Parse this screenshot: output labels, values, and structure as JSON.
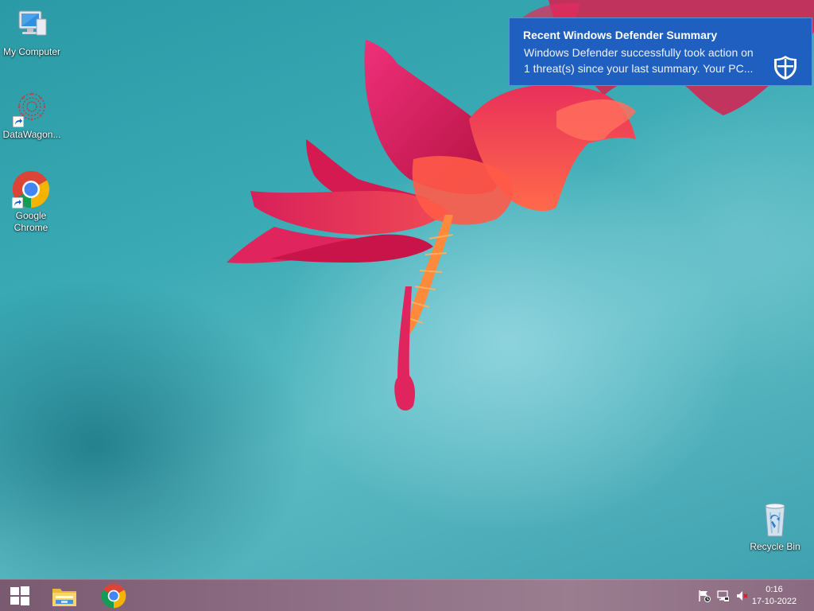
{
  "desktop": {
    "icons": [
      {
        "label": "My Computer",
        "icon": "computer-icon"
      },
      {
        "label": "DataWagon...",
        "icon": "datawagon-icon"
      },
      {
        "label": "Google Chrome",
        "icon": "chrome-icon"
      },
      {
        "label": "Recycle Bin",
        "icon": "recycle-bin-icon"
      }
    ]
  },
  "notification": {
    "title": "Recent Windows Defender Summary",
    "body": "Windows Defender successfully took action on 1 threat(s) since your last summary. Your PC...",
    "icon": "defender-shield-icon",
    "background": "#1f5fbf"
  },
  "taskbar": {
    "pinned": [
      {
        "name": "start-button",
        "icon": "windows-logo-icon"
      },
      {
        "name": "file-explorer-button",
        "icon": "folder-icon"
      },
      {
        "name": "chrome-taskbar-button",
        "icon": "chrome-icon"
      }
    ],
    "tray": [
      {
        "name": "action-center-icon"
      },
      {
        "name": "network-icon"
      },
      {
        "name": "volume-muted-icon"
      }
    ],
    "clock": {
      "time": "0:16",
      "date": "17-10-2022"
    }
  },
  "colors": {
    "wallpaper_teal": "#3aaab4",
    "flower_red": "#e0245e",
    "taskbar": "#8e6f86"
  }
}
